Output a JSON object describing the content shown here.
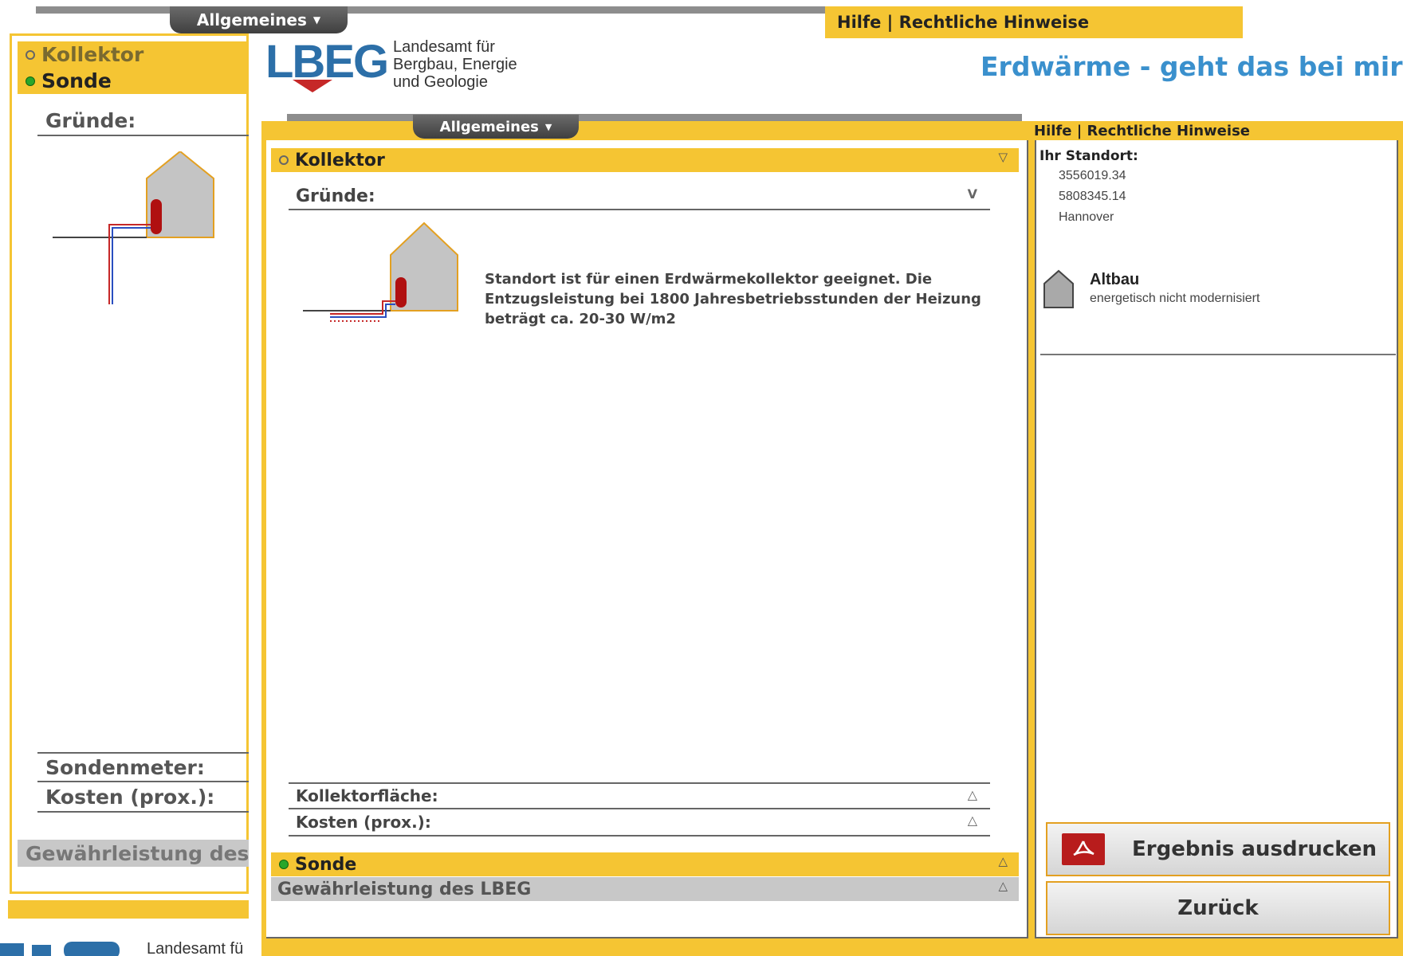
{
  "background": {
    "nav_tab": "Allgemeines",
    "links": "Hilfe | Rechtliche Hinweise",
    "sections": [
      "Kollektor",
      "Sonde"
    ],
    "gruende_label": "Gründe:",
    "sondenmeter_label": "Sondenmeter:",
    "kosten_label": "Kosten (prox.):",
    "footer_label": "Gewährleistung des LBEG",
    "logo_text_bottom": "Landesamt fü"
  },
  "header": {
    "logo_lbeg": "LBEG",
    "logo_line1": "Landesamt für",
    "logo_line2": "Bergbau, Energie",
    "logo_line3": "und Geologie",
    "title": "Erdwärme - geht das bei mir?"
  },
  "nav": {
    "tab_label": "Allgemeines",
    "links": "Hilfe | Rechtliche Hinweise"
  },
  "main": {
    "kollektor_label": "Kollektor",
    "gruende_label": "Gründe:",
    "reason_text": "Standort ist für einen Erdwärmekollektor geeignet. Die Entzugsleistung bei 1800 Jahresbetriebsstunden der Heizung beträgt ca. 20-30 W/m2",
    "kollektorflaeche_label": "Kollektorfläche:",
    "kosten_label": "Kosten (prox.):",
    "sonde_label": "Sonde",
    "gewaehrleistung_label": "Gewährleistung des LBEG",
    "chevron_down": "▽",
    "chevron_v": "V",
    "chevron_up": "△"
  },
  "sidebar": {
    "standort_label": "Ihr Standort:",
    "coord_x": "3556019.34",
    "coord_y": "5808345.14",
    "city": "Hannover",
    "building_type": "Altbau",
    "building_desc": "energetisch nicht modernisiert"
  },
  "actions": {
    "print_label": "Ergebnis ausdrucken",
    "back_label": "Zurück"
  },
  "colors": {
    "accent_yellow": "#f5c533",
    "title_blue": "#3a90cd",
    "logo_blue": "#2c6fa8",
    "status_green": "#2aa62a",
    "pdf_red": "#b81c1c"
  }
}
